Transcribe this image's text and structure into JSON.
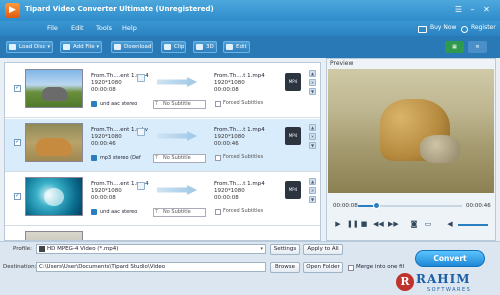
{
  "window": {
    "title": "Tipard Video Converter Ultimate (Unregistered)"
  },
  "menu": {
    "items": [
      "File",
      "Edit",
      "Tools",
      "Help"
    ],
    "buy_now": "Buy Now",
    "register": "Register"
  },
  "toolbar": {
    "load_disc": "Load Disc",
    "add_file": "Add File",
    "download": "Download",
    "clip": "Clip",
    "threed": "3D",
    "edit": "Edit"
  },
  "files": [
    {
      "src_name": "From.Th....ent 1.mp4",
      "src_res": "1920*1080",
      "src_dur": "00:00:08",
      "out_name": "From.Th....t 1.mp4",
      "out_res": "1920*1080",
      "out_dur": "00:00:08",
      "audio": "und aac stereo",
      "subtitle": "No Subtitle",
      "forced": "Forced Subtitles",
      "selected": false
    },
    {
      "src_name": "From.Th....ent 1.mkv",
      "src_res": "1920*1080",
      "src_dur": "00:00:46",
      "out_name": "From.Th....t 1.mp4",
      "out_res": "1920*1080",
      "out_dur": "00:00:46",
      "audio": "mp3 stereo (Def",
      "subtitle": "No Subtitle",
      "forced": "Forced Subtitles",
      "selected": true
    },
    {
      "src_name": "From.Th....ent 1.mp4",
      "src_res": "1920*1080",
      "src_dur": "00:00:08",
      "out_name": "From.Th....t 1.mp4",
      "out_res": "1920*1080",
      "out_dur": "00:00:08",
      "audio": "und aac stereo",
      "subtitle": "No Subtitle",
      "forced": "Forced Subtitles",
      "selected": false
    }
  ],
  "preview": {
    "label": "Preview",
    "current_time": "00:00:08",
    "total_time": "00:00:46",
    "progress": 0.17
  },
  "bottom": {
    "profile_label": "Profile:",
    "profile_value": "HD MPEG-4 Video (*.mp4)",
    "settings": "Settings",
    "apply_all": "Apply to All",
    "destination_label": "Destination:",
    "destination_value": "C:\\Users\\User\\Documents\\Tipard Studio\\Video",
    "browse": "Browse",
    "open_folder": "Open Folder",
    "merge": "Merge into one fil",
    "convert": "Convert"
  },
  "watermark": {
    "letter": "R",
    "name": "RAHIM",
    "sub": "SOFTWARES"
  }
}
